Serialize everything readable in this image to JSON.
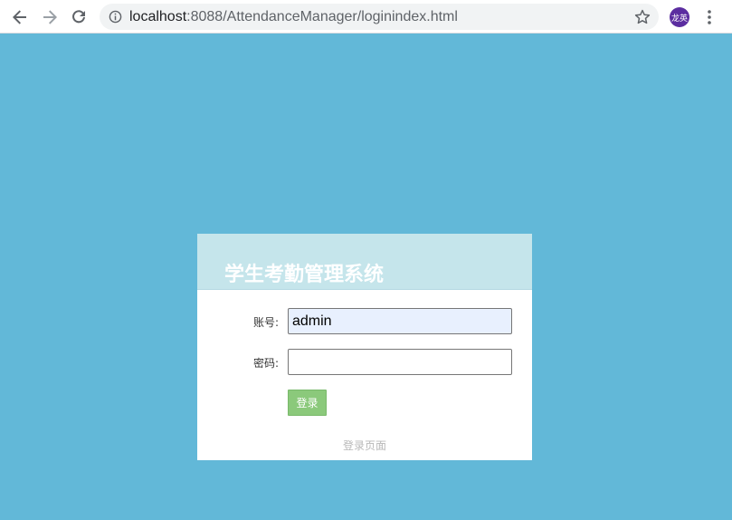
{
  "browser": {
    "url_host": "localhost",
    "url_path": ":8088/AttendanceManager/loginindex.html",
    "avatar_text": "龙英",
    "icons": {
      "back": "back-arrow-icon",
      "forward": "forward-arrow-icon",
      "reload": "reload-icon",
      "info": "info-icon",
      "bookmark": "star-icon",
      "menu": "more-vert-icon"
    }
  },
  "page": {
    "background_color": "#62b8d8"
  },
  "login": {
    "title": "学生考勤管理系统",
    "account_label": "账号:",
    "account_value": "admin",
    "password_label": "密码:",
    "password_value": "",
    "submit_label": "登录",
    "footer": "登录页面",
    "header_color": "#c5e5eb",
    "button_color": "#8bc97b"
  }
}
